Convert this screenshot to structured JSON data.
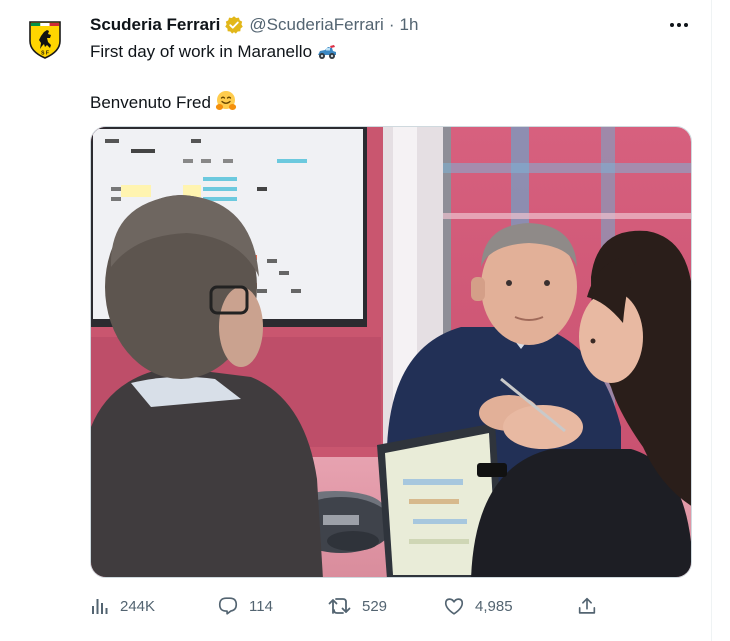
{
  "tweet": {
    "display_name": "Scuderia Ferrari",
    "handle": "@ScuderiaFerrari",
    "separator": "·",
    "time": "1h",
    "line1": "First day of work in Maranello",
    "line2": "Benvenuto Fred"
  },
  "stats": {
    "views": "244K",
    "replies": "114",
    "retweets": "529",
    "likes": "4,985"
  },
  "icons": {
    "avatar": "ferrari-prancing-horse-logo",
    "verified": "verified-badge-icon",
    "more": "more-options-icon",
    "line1_emoji": "racing-car-emoji",
    "line2_emoji": "hugging-face-emoji",
    "views": "analytics-icon",
    "reply": "reply-icon",
    "retweet": "retweet-icon",
    "like": "heart-icon",
    "share": "share-icon"
  },
  "colors": {
    "text": "#0f1419",
    "secondary": "#536471",
    "verified": "#e2b719",
    "ferrari_yellow": "#ffd500"
  }
}
